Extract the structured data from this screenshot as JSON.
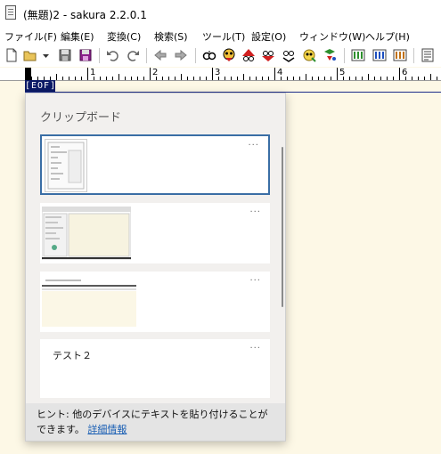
{
  "window": {
    "title": "(無題)2 - sakura 2.2.0.1"
  },
  "menu": [
    {
      "label": "ファイル(F)"
    },
    {
      "label": "編集(E)"
    },
    {
      "label": "変換(C)"
    },
    {
      "label": "検索(S)"
    },
    {
      "label": "ツール(T)"
    },
    {
      "label": "設定(O)"
    },
    {
      "label": "ウィンドウ(W)"
    },
    {
      "label": "ヘルプ(H)"
    }
  ],
  "toolbar": {
    "icons": [
      "new-file-icon",
      "open-file-icon",
      "dropdown-arrow-icon",
      "save-icon",
      "save-all-icon",
      "undo-icon",
      "redo-icon",
      "back-icon",
      "forward-icon",
      "search-icon",
      "grep-icon",
      "find-prev-icon",
      "find-next-icon",
      "tag-jump-icon",
      "bookmark-icon",
      "outline-icon",
      "compare-icon",
      "settings-icon",
      "window-list-icon"
    ]
  },
  "ruler": {
    "labels": [
      "1",
      "2",
      "3",
      "4",
      "5",
      "6"
    ]
  },
  "editor": {
    "eof_marker": "[EOF]"
  },
  "clipboard": {
    "title": "クリップボード",
    "more_label": "···",
    "items": [
      {
        "type": "image",
        "selected": true
      },
      {
        "type": "image",
        "selected": false
      },
      {
        "type": "image",
        "selected": false
      },
      {
        "type": "text",
        "text": "テスト２",
        "selected": false
      }
    ],
    "hint": {
      "text": "ヒント: 他のデバイスにテキストを貼り付けることができます。",
      "link": "詳細情報"
    }
  },
  "colors": {
    "editor_background": "#fdf8e6",
    "eof_background": "#0b1a66",
    "selection_border": "#3a6ea5",
    "link": "#1a5fb4"
  }
}
